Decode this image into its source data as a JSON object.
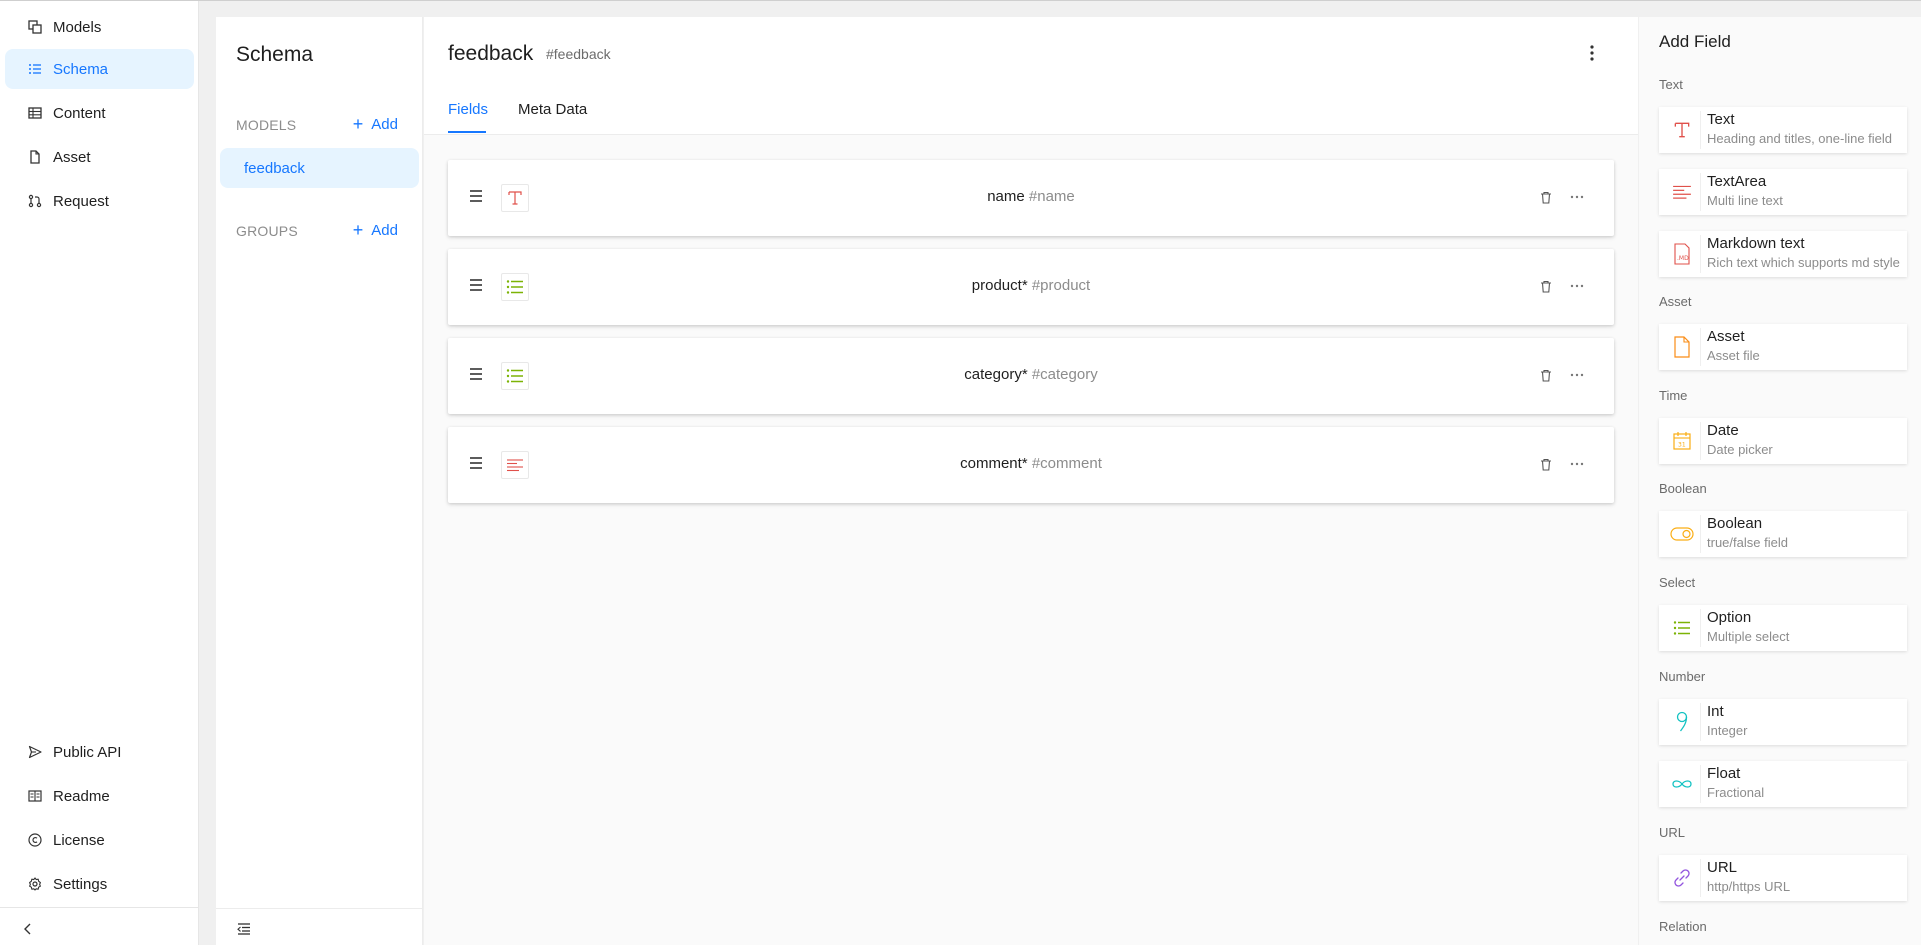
{
  "nav": {
    "items": [
      {
        "label": "Models",
        "icon": "models-icon"
      },
      {
        "label": "Schema",
        "icon": "schema-list-icon"
      },
      {
        "label": "Content",
        "icon": "table-icon"
      },
      {
        "label": "Asset",
        "icon": "file-icon"
      },
      {
        "label": "Request",
        "icon": "pull-request-icon"
      }
    ],
    "bottom_items": [
      {
        "label": "Public API",
        "icon": "send-icon"
      },
      {
        "label": "Readme",
        "icon": "book-icon"
      },
      {
        "label": "License",
        "icon": "copyright-icon"
      },
      {
        "label": "Settings",
        "icon": "gear-icon"
      }
    ],
    "active": "Schema"
  },
  "schema_panel": {
    "title": "Schema",
    "models_label": "MODELS",
    "groups_label": "GROUPS",
    "add_label": "Add",
    "models": [
      "feedback"
    ]
  },
  "main": {
    "model_name": "feedback",
    "model_key": "#feedback",
    "tabs": [
      "Fields",
      "Meta Data"
    ],
    "active_tab": "Fields",
    "fields": [
      {
        "name": "name",
        "key": "#name",
        "type": "text"
      },
      {
        "name": "product*",
        "key": "#product",
        "type": "option"
      },
      {
        "name": "category*",
        "key": "#category",
        "type": "option"
      },
      {
        "name": "comment*",
        "key": "#comment",
        "type": "textarea"
      }
    ]
  },
  "add_field": {
    "title": "Add Field",
    "groups": [
      {
        "label": "Text",
        "items": [
          {
            "name": "Text",
            "desc": "Heading and titles, one-line field",
            "icon": "text-type-icon"
          },
          {
            "name": "TextArea",
            "desc": "Multi line text",
            "icon": "textarea-icon"
          },
          {
            "name": "Markdown text",
            "desc": "Rich text which supports md style",
            "icon": "markdown-file-icon"
          }
        ]
      },
      {
        "label": "Asset",
        "items": [
          {
            "name": "Asset",
            "desc": "Asset file",
            "icon": "asset-file-icon"
          }
        ]
      },
      {
        "label": "Time",
        "items": [
          {
            "name": "Date",
            "desc": "Date picker",
            "icon": "calendar-icon"
          }
        ]
      },
      {
        "label": "Boolean",
        "items": [
          {
            "name": "Boolean",
            "desc": "true/false field",
            "icon": "toggle-icon"
          }
        ]
      },
      {
        "label": "Select",
        "items": [
          {
            "name": "Option",
            "desc": "Multiple select",
            "icon": "option-list-icon"
          }
        ]
      },
      {
        "label": "Number",
        "items": [
          {
            "name": "Int",
            "desc": "Integer",
            "icon": "integer-icon"
          },
          {
            "name": "Float",
            "desc": "Fractional",
            "icon": "infinity-icon"
          }
        ]
      },
      {
        "label": "URL",
        "items": [
          {
            "name": "URL",
            "desc": "http/https URL",
            "icon": "link-icon"
          }
        ]
      },
      {
        "label": "Relation",
        "items": []
      }
    ]
  },
  "colors": {
    "accent": "#1677ff",
    "active_bg": "#e6f4ff",
    "text_icon": "#e0504a",
    "option_icon": "#7cb305",
    "asset_icon": "#fa8c16",
    "date_icon": "#faad14",
    "int_icon": "#13c2c2",
    "url_icon": "#9254de"
  }
}
